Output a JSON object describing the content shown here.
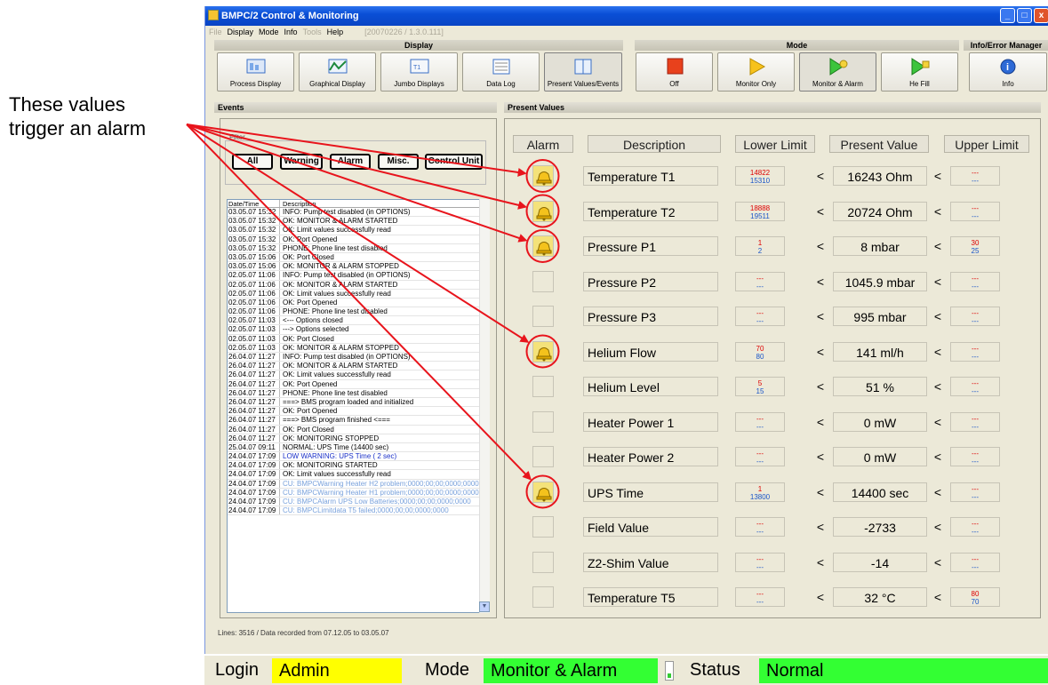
{
  "annotation": {
    "line1": "These values",
    "line2": "trigger an alarm"
  },
  "window": {
    "title": "BMPC/2 Control & Monitoring"
  },
  "menu": {
    "items": [
      "File",
      "Display",
      "Mode",
      "Info",
      "Tools",
      "Help"
    ],
    "version": "[20070226 / 1.3.0.111]"
  },
  "toolbar": {
    "display_group": "Display",
    "mode_group": "Mode",
    "info_group": "Info/Error Manager",
    "buttons": {
      "process_display": "Process Display",
      "graphical_display": "Graphical Display",
      "jumbo_displays": "Jumbo Displays",
      "data_log": "Data Log",
      "present_values": "Present Values/Events",
      "off": "Off",
      "monitor_only": "Monitor Only",
      "monitor_alarm": "Monitor & Alarm",
      "he_fill": "He Fill",
      "info": "Info"
    }
  },
  "events": {
    "title": "Events",
    "filter_label": "Filter",
    "filters": [
      "All",
      "Warning",
      "Alarm",
      "Misc.",
      "Control Unit"
    ],
    "columns": [
      "Date/Time",
      "Description"
    ],
    "rows": [
      [
        "03.05.07 15:32",
        "INFO: Pump test disabled (in OPTIONS)"
      ],
      [
        "03.05.07 15:32",
        "OK: MONITOR & ALARM STARTED"
      ],
      [
        "03.05.07 15:32",
        "OK: Limit values successfully read"
      ],
      [
        "03.05.07 15:32",
        "OK: Port Opened"
      ],
      [
        "03.05.07 15:32",
        "PHONE: Phone line test disabled"
      ],
      [
        "03.05.07 15:06",
        "OK: Port Closed"
      ],
      [
        "03.05.07 15:06",
        "OK: MONITOR & ALARM STOPPED"
      ],
      [
        "02.05.07 11:06",
        "INFO: Pump test disabled (in OPTIONS)"
      ],
      [
        "02.05.07 11:06",
        "OK: MONITOR & ALARM STARTED"
      ],
      [
        "02.05.07 11:06",
        "OK: Limit values successfully read"
      ],
      [
        "02.05.07 11:06",
        "OK: Port Opened"
      ],
      [
        "02.05.07 11:06",
        "PHONE: Phone line test disabled"
      ],
      [
        "02.05.07 11:03",
        "<--- Options closed"
      ],
      [
        "02.05.07 11:03",
        "---> Options selected"
      ],
      [
        "02.05.07 11:03",
        "OK: Port Closed"
      ],
      [
        "02.05.07 11:03",
        "OK: MONITOR & ALARM STOPPED"
      ],
      [
        "26.04.07 11:27",
        "INFO: Pump test disabled (in OPTIONS)"
      ],
      [
        "26.04.07 11:27",
        "OK: MONITOR & ALARM STARTED"
      ],
      [
        "26.04.07 11:27",
        "OK: Limit values successfully read"
      ],
      [
        "26.04.07 11:27",
        "OK: Port Opened"
      ],
      [
        "26.04.07 11:27",
        "PHONE: Phone line test disabled"
      ],
      [
        "26.04.07 11:27",
        "===> BMS program loaded and initialized"
      ],
      [
        "26.04.07 11:27",
        "OK: Port Opened"
      ],
      [
        "26.04.07 11:27",
        "===> BMS program finished <==="
      ],
      [
        "26.04.07 11:27",
        "OK: Port Closed"
      ],
      [
        "26.04.07 11:27",
        "OK: MONITORING STOPPED"
      ],
      [
        "25.04.07 09:11",
        "NORMAL: UPS Time (14400 sec)"
      ],
      [
        "24.04.07 17:09",
        "LOW WARNING: UPS Time (   2 sec)"
      ],
      [
        "24.04.07 17:09",
        "OK: MONITORING STARTED"
      ],
      [
        "24.04.07 17:09",
        "OK: Limit values successfully read"
      ],
      [
        "24.04.07 17:09",
        "CU: BMPCWarning Heater H2 problem;0000;00;00;0000;0000"
      ],
      [
        "24.04.07 17:09",
        "CU: BMPCWarning Heater H1 problem;0000;00;00;0000;0000"
      ],
      [
        "24.04.07 17:09",
        "CU: BMPCAlarm UPS Low Batteries;0000;00;00;0000;0000"
      ],
      [
        "24.04.07 17:09",
        "CU: BMPCLimitdata T5 failed;0000;00;00;0000;0000"
      ]
    ],
    "footer": "Lines: 3516 / Data recorded from 07.12.05 to 03.05.07"
  },
  "present": {
    "title": "Present Values",
    "headers": {
      "alarm": "Alarm",
      "description": "Description",
      "lower": "Lower Limit",
      "present": "Present Value",
      "upper": "Upper Limit"
    },
    "lt": "<",
    "rows": [
      {
        "alarm": true,
        "description": "Temperature T1",
        "lower1": "14822",
        "lower2": "15310",
        "value": "16243 Ohm",
        "upper1": "---",
        "upper2": "---"
      },
      {
        "alarm": true,
        "description": "Temperature T2",
        "lower1": "18888",
        "lower2": "19511",
        "value": "20724 Ohm",
        "upper1": "---",
        "upper2": "---"
      },
      {
        "alarm": true,
        "description": "Pressure P1",
        "lower1": "1",
        "lower2": "2",
        "value": "8 mbar",
        "upper1": "30",
        "upper2": "25"
      },
      {
        "alarm": false,
        "description": "Pressure P2",
        "lower1": "---",
        "lower2": "---",
        "value": "1045.9 mbar",
        "upper1": "---",
        "upper2": "---"
      },
      {
        "alarm": false,
        "description": "Pressure P3",
        "lower1": "---",
        "lower2": "---",
        "value": "995 mbar",
        "upper1": "---",
        "upper2": "---"
      },
      {
        "alarm": true,
        "description": "Helium Flow",
        "lower1": "70",
        "lower2": "80",
        "value": "141 ml/h",
        "upper1": "---",
        "upper2": "---"
      },
      {
        "alarm": false,
        "description": "Helium Level",
        "lower1": "5",
        "lower2": "15",
        "value": "51 %",
        "upper1": "---",
        "upper2": "---"
      },
      {
        "alarm": false,
        "description": "Heater Power 1",
        "lower1": "---",
        "lower2": "---",
        "value": "0 mW",
        "upper1": "---",
        "upper2": "---"
      },
      {
        "alarm": false,
        "description": "Heater Power 2",
        "lower1": "---",
        "lower2": "---",
        "value": "0 mW",
        "upper1": "---",
        "upper2": "---"
      },
      {
        "alarm": true,
        "description": "UPS Time",
        "lower1": "1",
        "lower2": "13800",
        "value": "14400 sec",
        "upper1": "---",
        "upper2": "---"
      },
      {
        "alarm": false,
        "description": "Field Value",
        "lower1": "---",
        "lower2": "---",
        "value": "-2733",
        "upper1": "---",
        "upper2": "---"
      },
      {
        "alarm": false,
        "description": "Z2-Shim Value",
        "lower1": "---",
        "lower2": "---",
        "value": "-14",
        "upper1": "---",
        "upper2": "---"
      },
      {
        "alarm": false,
        "description": "Temperature T5",
        "lower1": "---",
        "lower2": "---",
        "value": "32 °C",
        "upper1": "80",
        "upper2": "70"
      }
    ]
  },
  "status": {
    "login_label": "Login",
    "login_value": "Admin",
    "mode_label": "Mode",
    "mode_value": "Monitor & Alarm",
    "status_label": "Status",
    "status_value": "Normal",
    "colors": {
      "login": "#ffff00",
      "mode": "#33ff33",
      "status": "#33ff33"
    }
  }
}
